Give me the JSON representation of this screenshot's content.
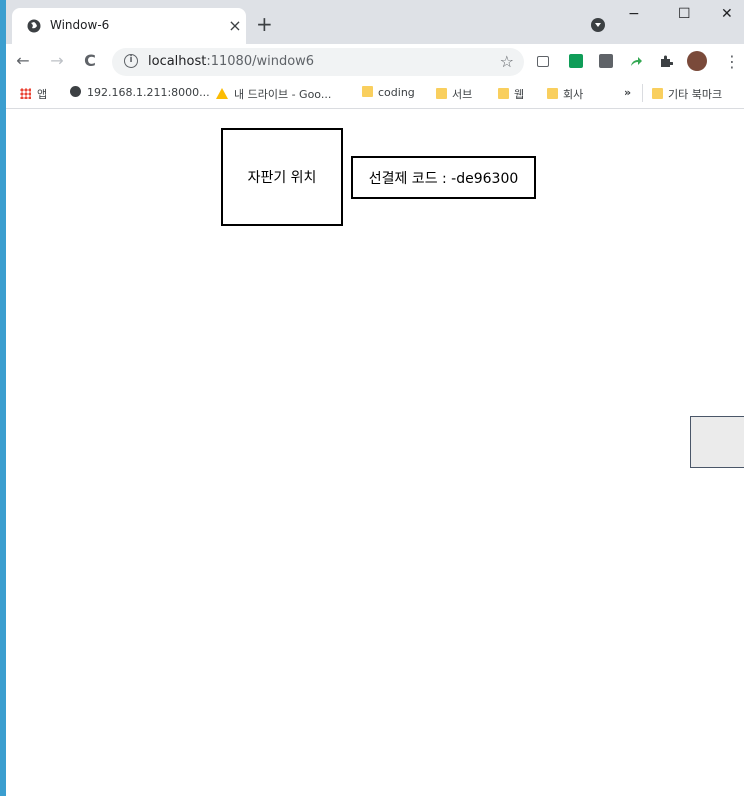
{
  "browser": {
    "tab": {
      "title": "Window-6",
      "close": "×"
    },
    "new_tab": "+",
    "window_controls": {
      "minimize": "−",
      "maximize": "☐",
      "close": "✕"
    },
    "nav": {
      "back": "←",
      "forward": "→",
      "reload": "C"
    },
    "address": {
      "host": "localhost",
      "path": ":11080/window6",
      "info_icon": "i",
      "star": "☆"
    },
    "menu": "⋮",
    "bookmarks": {
      "apps": "앱",
      "items": [
        "192.168.1.211:8000...",
        "내 드라이브 - Goo...",
        "coding",
        "서브",
        "웹",
        "회사"
      ],
      "more": "»",
      "other": "기타 북마크"
    }
  },
  "page": {
    "vending_location": "자판기 위치",
    "prepay_code": "선결제 코드 : -de96300"
  }
}
